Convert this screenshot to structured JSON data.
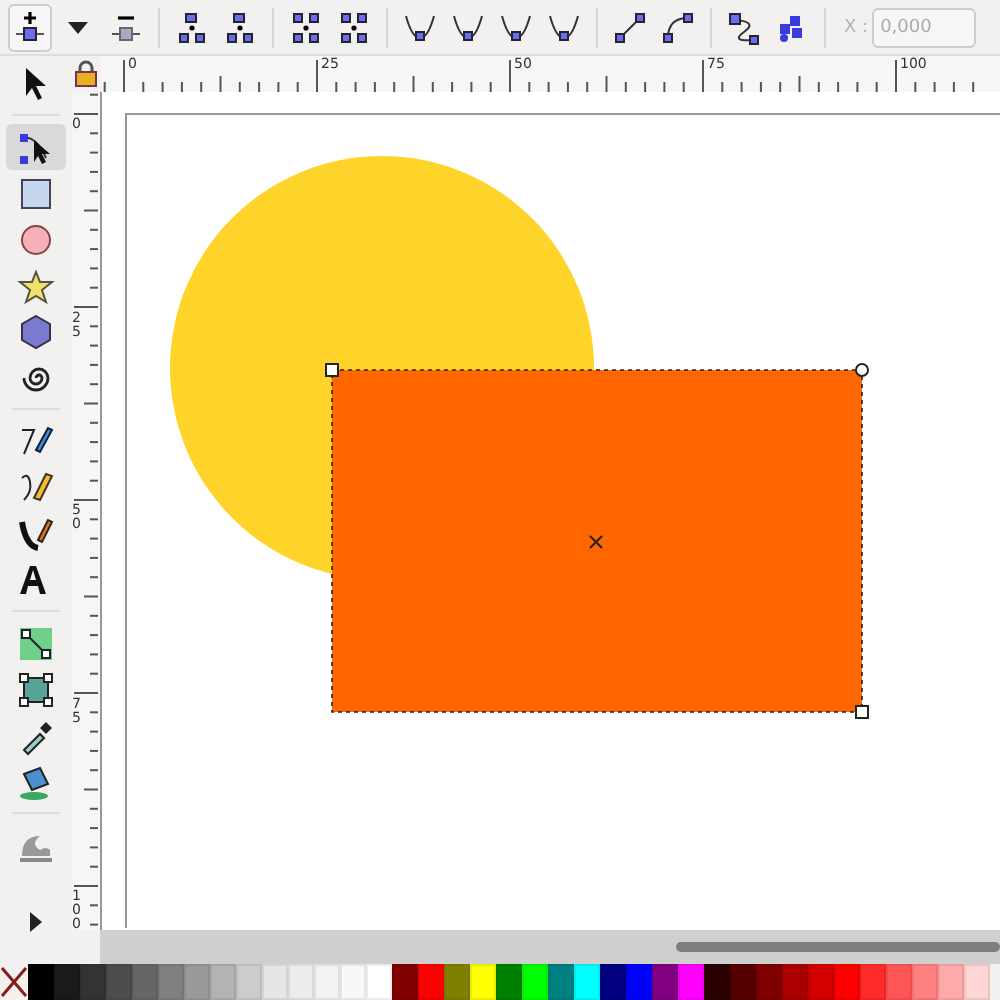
{
  "toolbar": {
    "x_field": {
      "label": "X :",
      "value": "0,000",
      "disabled": true
    }
  },
  "tools": [
    {
      "kind": "selector",
      "selected": false
    },
    {
      "kind": "node",
      "selected": true
    },
    {
      "kind": "rect",
      "selected": false
    },
    {
      "kind": "ellipse",
      "selected": false
    },
    {
      "kind": "star",
      "selected": false
    },
    {
      "kind": "box3d",
      "selected": false
    },
    {
      "kind": "spiral",
      "selected": false
    },
    {
      "kind": "pen",
      "selected": false
    },
    {
      "kind": "pencil",
      "selected": false
    },
    {
      "kind": "calligraphy",
      "selected": false
    },
    {
      "kind": "text",
      "selected": false
    },
    {
      "kind": "gradient",
      "selected": false
    },
    {
      "kind": "mesh",
      "selected": false
    },
    {
      "kind": "dropper",
      "selected": false
    },
    {
      "kind": "bucket",
      "selected": false
    },
    {
      "kind": "wave",
      "selected": false
    }
  ],
  "ruler_h": {
    "labels": [
      "0",
      "25",
      "50",
      "75",
      "100"
    ]
  },
  "ruler_v": {
    "labels": [
      "0",
      "25",
      "50",
      "75",
      "100"
    ]
  },
  "palette": [
    {
      "color": "#000000"
    },
    {
      "color": "#1a1a1a"
    },
    {
      "color": "#333333"
    },
    {
      "color": "#4d4d4d"
    },
    {
      "color": "#666666"
    },
    {
      "color": "#808080"
    },
    {
      "color": "#999999"
    },
    {
      "color": "#b3b3b3"
    },
    {
      "color": "#cccccc"
    },
    {
      "color": "#e6e6e6"
    },
    {
      "color": "#ececec"
    },
    {
      "color": "#f2f2f2"
    },
    {
      "color": "#f8f8f8"
    },
    {
      "color": "#ffffff"
    },
    {
      "color": "#800000"
    },
    {
      "color": "#ff0000"
    },
    {
      "color": "#808000"
    },
    {
      "color": "#ffff00"
    },
    {
      "color": "#008000"
    },
    {
      "color": "#00ff00"
    },
    {
      "color": "#008080"
    },
    {
      "color": "#00ffff"
    },
    {
      "color": "#000080"
    },
    {
      "color": "#0000ff"
    },
    {
      "color": "#800080"
    },
    {
      "color": "#ff00ff"
    },
    {
      "color": "#2b0000"
    },
    {
      "color": "#550000"
    },
    {
      "color": "#800001"
    },
    {
      "color": "#aa0000"
    },
    {
      "color": "#d40000"
    },
    {
      "color": "#ff0001"
    },
    {
      "color": "#ff2a2a"
    },
    {
      "color": "#ff5555"
    },
    {
      "color": "#ff8080"
    },
    {
      "color": "#ffaaaa"
    },
    {
      "color": "#ffd5d5"
    }
  ]
}
